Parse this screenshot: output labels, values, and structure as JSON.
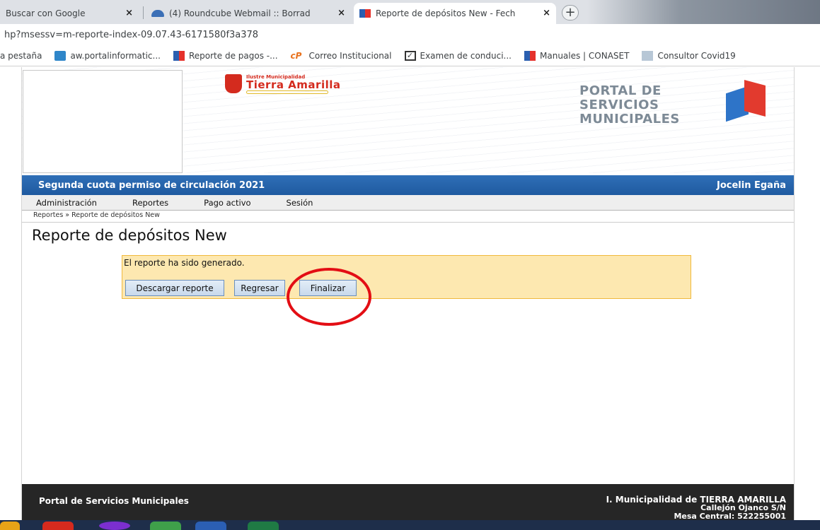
{
  "browser": {
    "tabs": [
      {
        "label": "Buscar con Google",
        "active": false
      },
      {
        "label": "(4) Roundcube Webmail :: Borrad",
        "active": false
      },
      {
        "label": "Reporte de depósitos New - Fech",
        "active": true
      }
    ],
    "new_tab_label": "+",
    "close_glyph": "×",
    "address": "hp?msessv=m-reporte-index-09.07.43-6171580f3a378",
    "bookmarks": [
      {
        "label": "a pestaña",
        "icon": "none"
      },
      {
        "label": "aw.portalinformatic...",
        "icon": "aw-icon"
      },
      {
        "label": "Reporte de pagos -...",
        "icon": "cube-icon"
      },
      {
        "label": "Correo Institucional",
        "icon": "cp-icon"
      },
      {
        "label": "Examen de conduci...",
        "icon": "checkbox-icon"
      },
      {
        "label": "Manuales | CONASET",
        "icon": "cube-icon"
      },
      {
        "label": "Consultor Covid19",
        "icon": "document-icon"
      }
    ]
  },
  "header": {
    "muni_small": "Ilustre Municipalidad",
    "muni_name": "Tierra Amarilla",
    "portal_title": [
      "PORTAL DE",
      "SERVICIOS",
      "MUNICIPALES"
    ]
  },
  "titlebar": {
    "left": "Segunda cuota permiso de circulación 2021",
    "right": "Jocelin Egaña"
  },
  "menu": [
    "Administración",
    "Reportes",
    "Pago activo",
    "Sesión"
  ],
  "breadcrumb": "Reportes » Reporte de depósitos New",
  "page_title": "Reporte de depósitos New",
  "message": {
    "text": "El reporte ha sido generado.",
    "buttons": [
      "Descargar reporte",
      "Regresar",
      "Finalizar"
    ]
  },
  "footer": {
    "left": "Portal de Servicios Municipales",
    "right_title": "I. Municipalidad de TIERRA AMARILLA",
    "address": "Callejón Ojanco S/N",
    "phone": "Mesa Central: 522255001"
  },
  "colors": {
    "titlebar_blue": "#1f5aa0",
    "message_bg": "#fde8b0",
    "message_border": "#f0b93d",
    "annotation_red": "#e30e14",
    "footer_bg": "#262626"
  }
}
